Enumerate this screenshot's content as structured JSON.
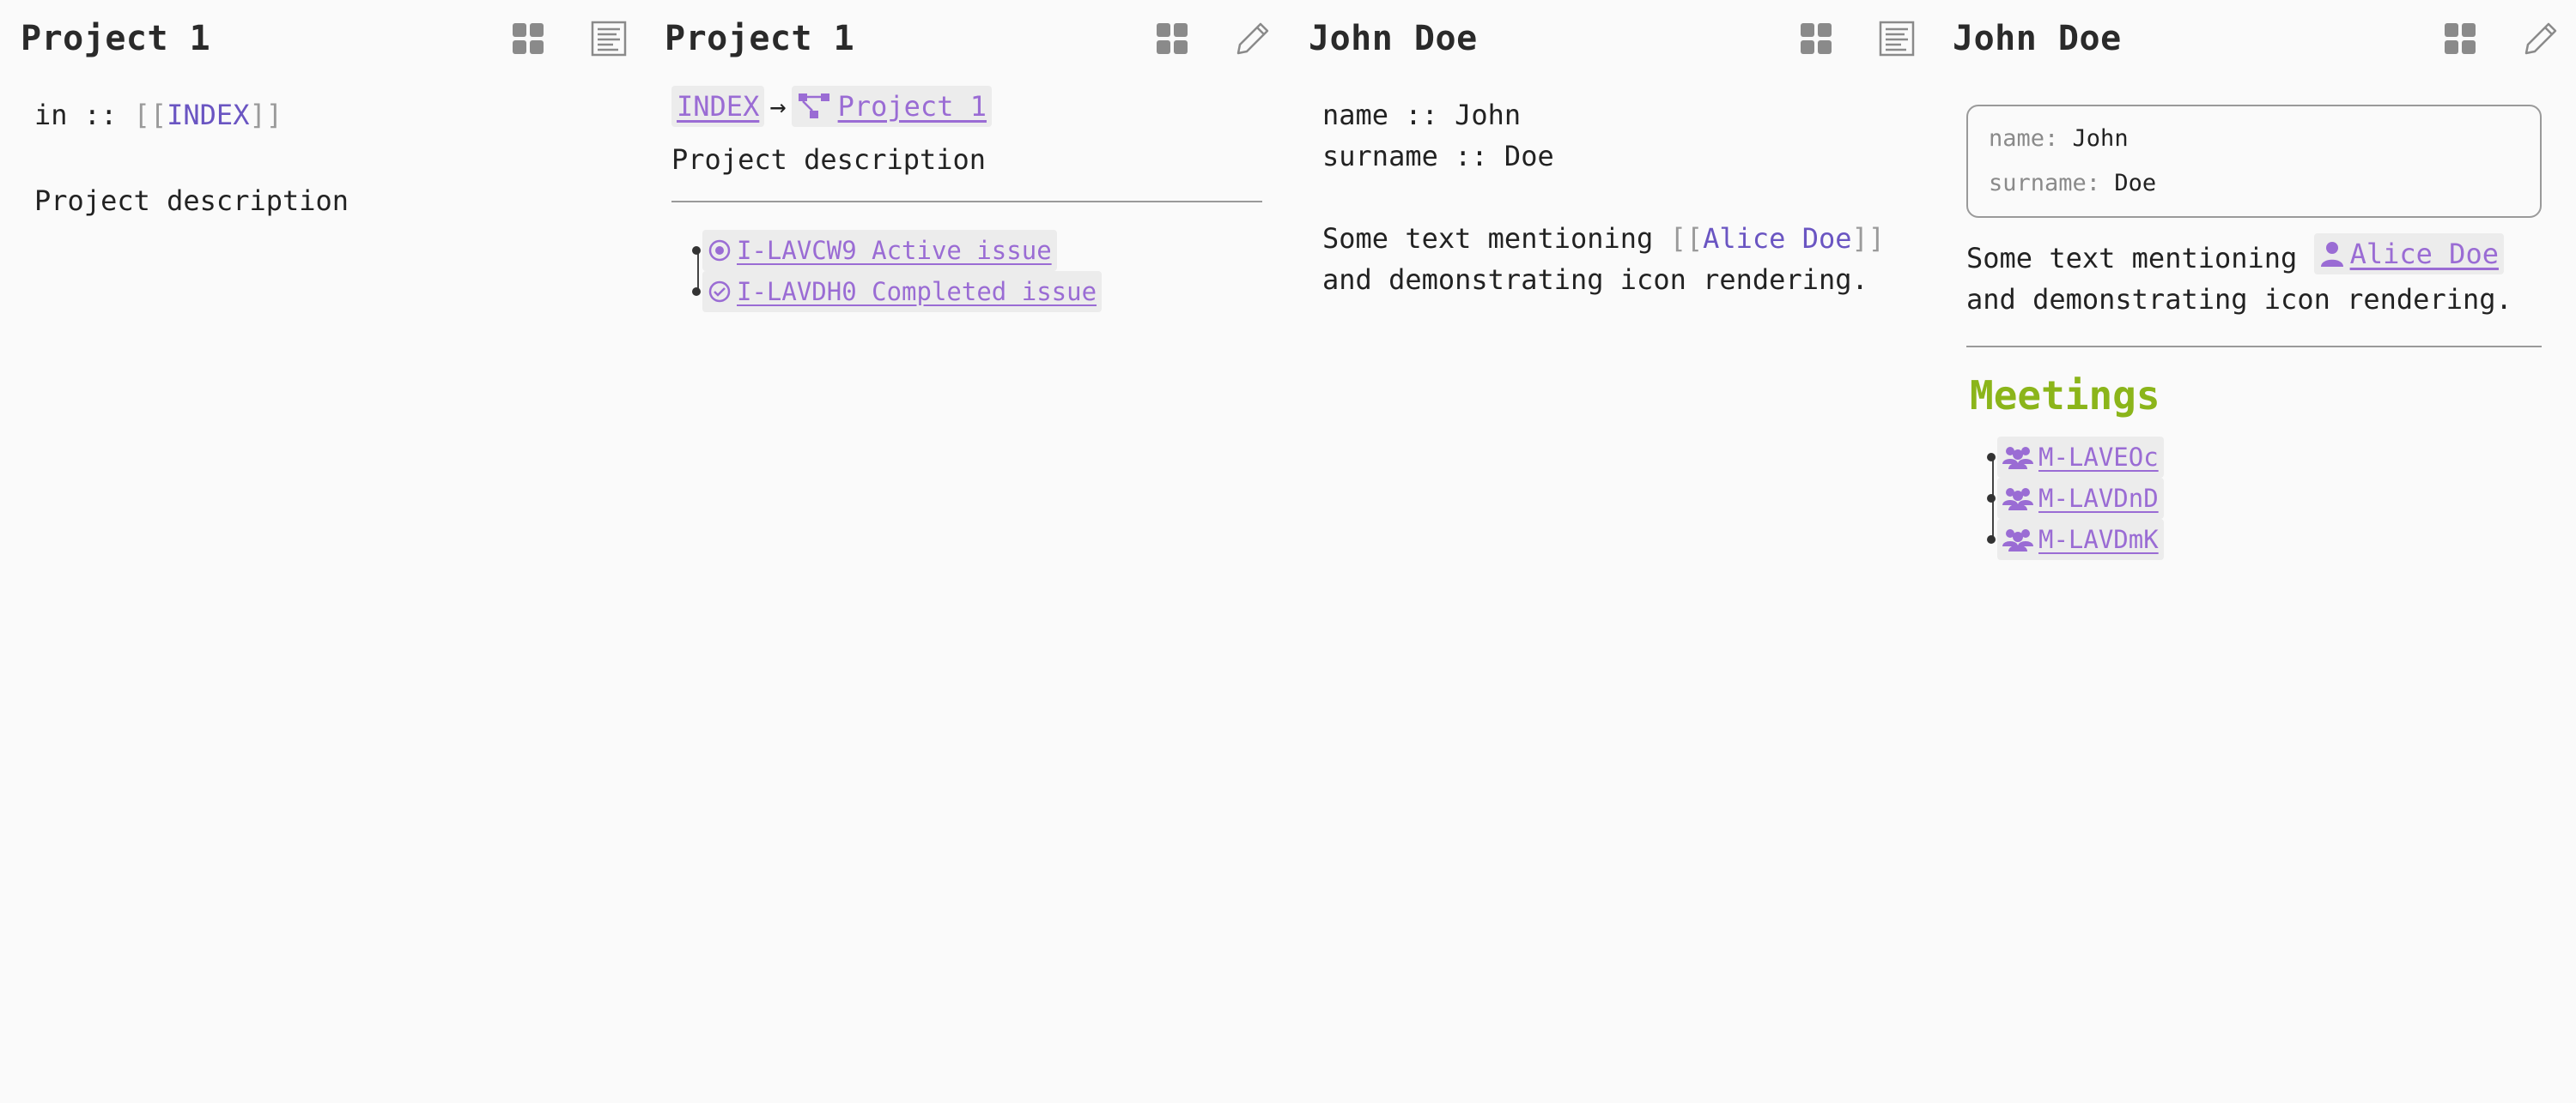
{
  "panels": [
    {
      "title": "Project 1",
      "icons": [
        "grid-icon",
        "document-icon"
      ],
      "in_key": "in",
      "in_sep": "::",
      "bracket_open": "[[",
      "in_link": "INDEX",
      "bracket_close": "]]",
      "description": "Project description"
    },
    {
      "title": "Project 1",
      "icons": [
        "grid-icon",
        "pencil-icon"
      ],
      "breadcrumb": {
        "root": "INDEX",
        "arrow": "→",
        "current": "Project 1"
      },
      "description": "Project description",
      "issues": [
        {
          "label": "I-LAVCW9 Active issue",
          "icon": "active-issue-icon"
        },
        {
          "label": "I-LAVDH0 Completed issue",
          "icon": "completed-issue-icon"
        }
      ]
    },
    {
      "title": "John Doe",
      "icons": [
        "grid-icon",
        "document-icon"
      ],
      "props": [
        {
          "key": "name",
          "sep": "::",
          "value": "John"
        },
        {
          "key": "surname",
          "sep": "::",
          "value": "Doe"
        }
      ],
      "text_before": "Some text mentioning",
      "bracket_open": "[[",
      "mention": "Alice Doe",
      "bracket_close": "]]",
      "text_after": "and demonstrating icon rendering."
    },
    {
      "title": "John Doe",
      "icons": [
        "grid-icon",
        "pencil-icon"
      ],
      "props": [
        {
          "key": "name:",
          "value": "John"
        },
        {
          "key": "surname:",
          "value": "Doe"
        }
      ],
      "text_before": "Some text mentioning",
      "mention": "Alice Doe",
      "text_after": "and demonstrating icon rendering.",
      "meetings_title": "Meetings",
      "meetings": [
        {
          "label": "M-LAVEOc",
          "icon": "people-icon"
        },
        {
          "label": "M-LAVDnD",
          "icon": "people-icon"
        },
        {
          "label": "M-LAVDmK",
          "icon": "people-icon"
        }
      ]
    }
  ],
  "colors": {
    "background": "#fafafa",
    "link": "#9a6cd4",
    "wikilink": "#6a55c2",
    "bracket": "#9a9a9a",
    "heading_green": "#8bb51a",
    "icon_gray": "#8a8a8a"
  }
}
